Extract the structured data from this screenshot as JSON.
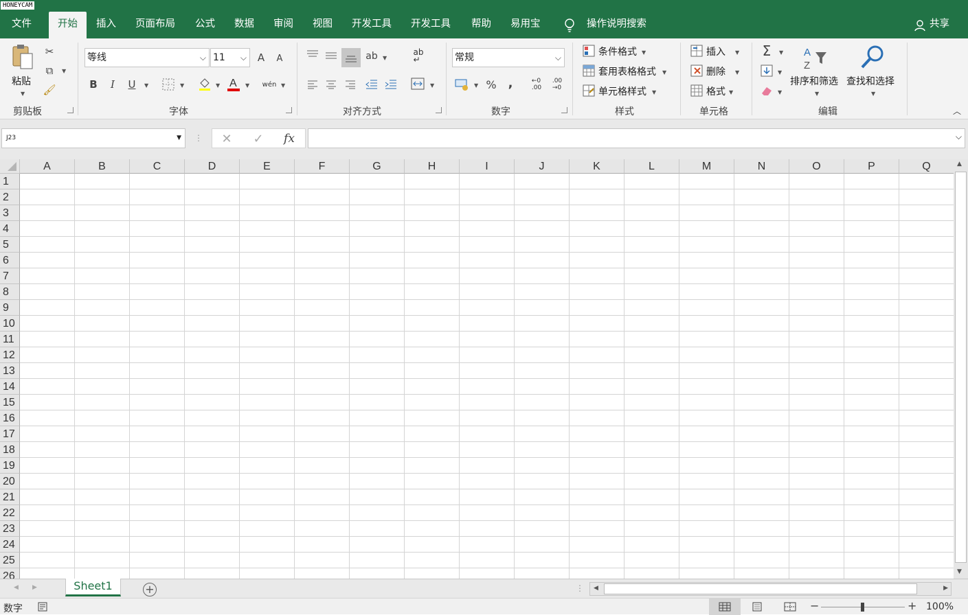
{
  "watermark": "HONEYCAM",
  "tabs": [
    {
      "label": "文件",
      "active": false
    },
    {
      "label": "开始",
      "active": true
    },
    {
      "label": "插入",
      "active": false
    },
    {
      "label": "页面布局",
      "active": false
    },
    {
      "label": "公式",
      "active": false
    },
    {
      "label": "数据",
      "active": false
    },
    {
      "label": "审阅",
      "active": false
    },
    {
      "label": "视图",
      "active": false
    },
    {
      "label": "开发工具",
      "active": false
    },
    {
      "label": "开发工具",
      "active": false
    },
    {
      "label": "帮助",
      "active": false
    },
    {
      "label": "易用宝",
      "active": false
    }
  ],
  "tell_me": "操作说明搜索",
  "share": "共享",
  "ribbon": {
    "clipboard": {
      "group": "剪贴板",
      "paste": "粘贴"
    },
    "font": {
      "group": "字体",
      "font_name": "等线",
      "font_size": "11",
      "bold": "B",
      "italic": "I",
      "underline": "U",
      "grow": "A",
      "shrink": "A",
      "phonetic": "wén",
      "color_letter": "A"
    },
    "alignment": {
      "group": "对齐方式"
    },
    "number": {
      "group": "数字",
      "format": "常规",
      "percent": "%",
      "comma": ","
    },
    "styles": {
      "group": "样式",
      "conditional": "条件格式",
      "table_format": "套用表格格式",
      "cell_styles": "单元格样式"
    },
    "cells": {
      "group": "单元格",
      "insert": "插入",
      "delete": "删除",
      "format": "格式"
    },
    "editing": {
      "group": "编辑",
      "sort_filter": "排序和筛选",
      "find_select": "查找和选择",
      "sigma": "Σ"
    }
  },
  "formula_bar": {
    "name_box": "J23",
    "fx": "fx",
    "value": ""
  },
  "columns": [
    "A",
    "B",
    "C",
    "D",
    "E",
    "F",
    "G",
    "H",
    "I",
    "J",
    "K",
    "L",
    "M",
    "N",
    "O",
    "P",
    "Q"
  ],
  "rows": [
    "1",
    "2",
    "3",
    "4",
    "5",
    "6",
    "7",
    "8",
    "9",
    "10",
    "11",
    "12",
    "13",
    "14",
    "15",
    "16",
    "17",
    "18",
    "19",
    "20",
    "21",
    "22",
    "23",
    "24",
    "25",
    "26"
  ],
  "sheets": [
    "Sheet1"
  ],
  "status": {
    "mode": "数字",
    "zoom": "100%"
  },
  "colors": {
    "accent": "#217346",
    "ribbon_bg": "#f3f3f3",
    "gridline": "#d4d4d4"
  }
}
